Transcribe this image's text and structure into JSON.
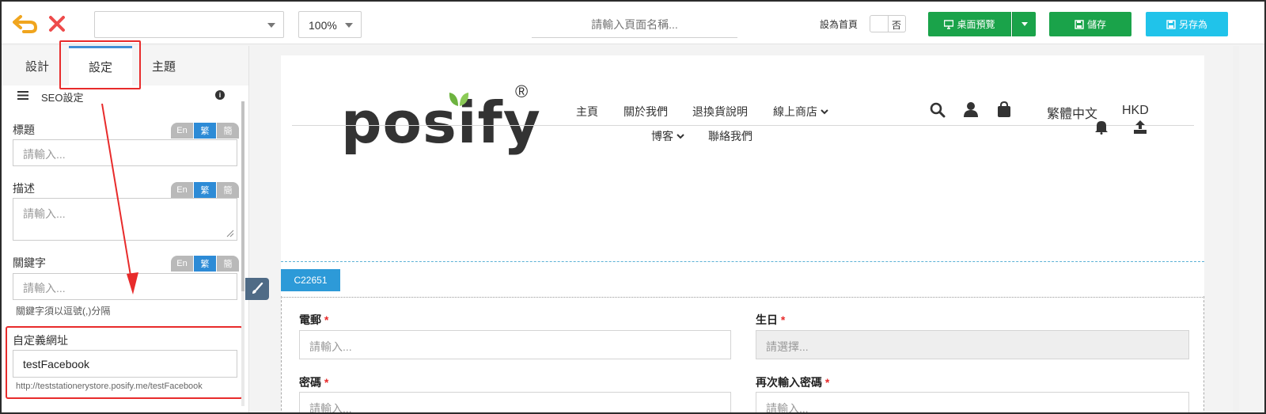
{
  "toolbar": {
    "zoom": "100%",
    "page_name_placeholder": "請輸入頁面名稱...",
    "set_home_label": "設為首頁",
    "set_home_value": "否",
    "preview_label": "桌面預覽",
    "save_label": "儲存",
    "save_as_label": "另存為"
  },
  "left_panel": {
    "tabs": [
      {
        "label": "設計"
      },
      {
        "label": "設定"
      },
      {
        "label": "主題"
      }
    ],
    "section_title": "SEO設定",
    "lang_options": [
      "En",
      "繁",
      "簡"
    ],
    "fields": {
      "title": {
        "label": "標題",
        "placeholder": "請輸入..."
      },
      "description": {
        "label": "描述",
        "placeholder": "請輸入..."
      },
      "keywords": {
        "label": "關鍵字",
        "placeholder": "請輸入...",
        "hint": "關鍵字須以逗號(,)分隔"
      },
      "custom_url": {
        "label": "自定義網址",
        "value": "testFacebook",
        "hint": "http://teststationerystore.posify.me/testFacebook"
      }
    }
  },
  "preview": {
    "logo_text": "posify",
    "logo_reg": "®",
    "nav": [
      "主頁",
      "關於我們",
      "退換貨說明",
      "線上商店",
      "博客",
      "聯絡我們"
    ],
    "language": "繁體中文",
    "currency": "HKD",
    "section_tag": "C22651",
    "form": {
      "email_label": "電郵",
      "email_placeholder": "請輸入...",
      "birthday_label": "生日",
      "birthday_placeholder": "請選擇...",
      "password_label": "密碼",
      "password_placeholder": "請輸入...",
      "confirm_password_label": "再次輸入密碼",
      "confirm_password_placeholder": "請輸入...",
      "required_mark": "*"
    }
  },
  "colors": {
    "accent_green": "#1aa34a",
    "accent_cyan": "#20c3ea",
    "tab_blue": "#2d8bd6",
    "annotation_red": "#e82b2b",
    "logo_leaf_green": "#6db33f"
  }
}
